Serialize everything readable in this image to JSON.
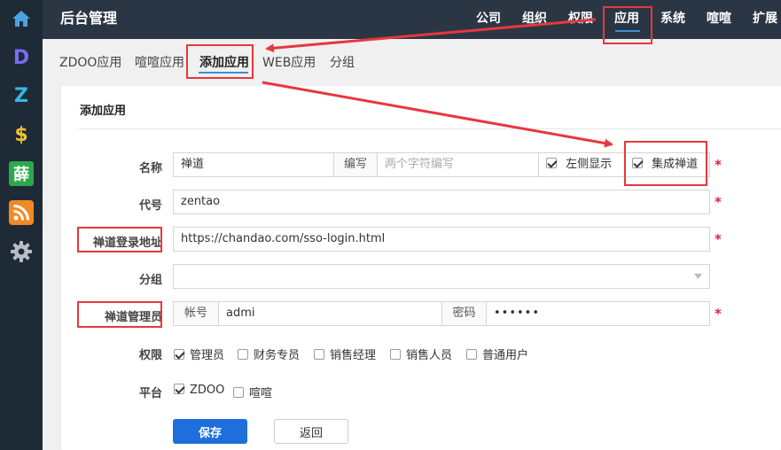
{
  "rail": {
    "icons": [
      "home-icon",
      "d-logo-icon",
      "z-logo-icon",
      "dollar-icon",
      "xue-logo-icon",
      "rss-icon",
      "gear-icon"
    ],
    "d_letter": "D",
    "z_letter": "Z",
    "dollar_letter": "$",
    "xue_char": "薛"
  },
  "header": {
    "title": "后台管理",
    "nav": [
      "公司",
      "组织",
      "权限",
      "应用",
      "系统",
      "喧喧",
      "扩展"
    ],
    "active_nav": "应用"
  },
  "subnav": {
    "items": [
      "ZDOO应用",
      "喧喧应用",
      "添加应用",
      "WEB应用",
      "分组"
    ],
    "active": "添加应用"
  },
  "form": {
    "title": "添加应用",
    "name_label": "名称",
    "name_value": "禅道",
    "abbr_addon": "编写",
    "abbr_placeholder": "两个字符编写",
    "left_display_label": "左侧显示",
    "integrate_label": "集成禅道",
    "code_label": "代号",
    "code_value": "zentao",
    "login_url_label": "禅道登录地址",
    "login_url_value": "https://chandao.com/sso-login.html",
    "group_label": "分组",
    "admin_label": "禅道管理员",
    "account_addon": "帐号",
    "account_value": "admi",
    "password_addon": "密码",
    "password_value": "••••••",
    "perm_label": "权限",
    "perm_options": [
      "管理员",
      "财务专员",
      "销售经理",
      "销售人员",
      "普通用户"
    ],
    "platform_label": "平台",
    "platform_options": [
      "ZDOO",
      "喧喧"
    ],
    "save_label": "保存",
    "back_label": "返回",
    "required_mark": "*"
  },
  "colors": {
    "accent": "#1e6fdc",
    "annotation": "#e8373d",
    "required": "#e0204d"
  }
}
